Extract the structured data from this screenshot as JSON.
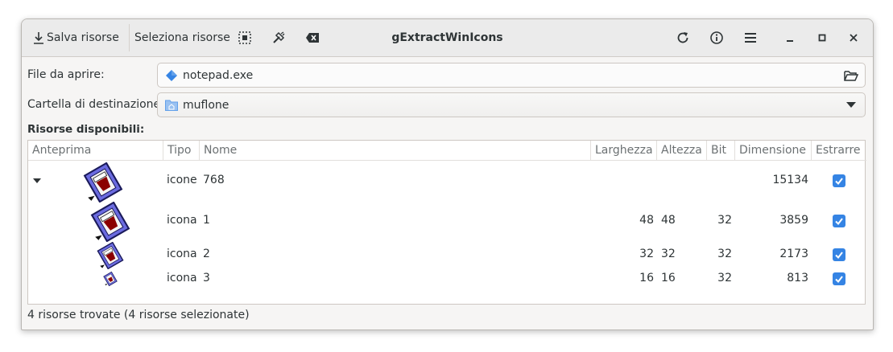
{
  "window": {
    "title": "gExtractWinIcons"
  },
  "toolbar": {
    "save_label": "Salva risorse",
    "select_label": "Seleziona risorse",
    "select_all_icon": "select-all-icon",
    "deselect_icon": "deselect-brush-icon",
    "clear_icon": "backspace-clear-icon",
    "refresh_icon": "refresh-icon",
    "info_icon": "info-icon",
    "menu_icon": "hamburger-menu-icon"
  },
  "form": {
    "file_label": "File da aprire:",
    "file_value": "notepad.exe",
    "dest_label": "Cartella di destinazione:",
    "dest_value": "muflone"
  },
  "resources": {
    "section_title": "Risorse disponibili:",
    "columns": [
      "Anteprima",
      "Tipo",
      "Nome",
      "Larghezza",
      "Altezza",
      "Bit",
      "Dimensione",
      "Estrarre"
    ],
    "rows": [
      {
        "type": "icone",
        "name": "768",
        "width": "",
        "height": "",
        "bits": "",
        "size": "15134",
        "extract": true,
        "expander": true,
        "preview_size": 48
      },
      {
        "type": "icona",
        "name": "1",
        "width": "48",
        "height": "48",
        "bits": "32",
        "size": "3859",
        "extract": true,
        "expander": false,
        "preview_size": 48
      },
      {
        "type": "icona",
        "name": "2",
        "width": "32",
        "height": "32",
        "bits": "32",
        "size": "2173",
        "extract": true,
        "expander": false,
        "preview_size": 32
      },
      {
        "type": "icona",
        "name": "3",
        "width": "16",
        "height": "16",
        "bits": "32",
        "size": "813",
        "extract": true,
        "expander": false,
        "preview_size": 16
      }
    ]
  },
  "status": {
    "text": "4 risorse trovate (4 risorse selezionate)"
  },
  "colors": {
    "accent": "#3584e4",
    "header_bg": "#ebebeb",
    "window_bg": "#f6f5f4"
  }
}
